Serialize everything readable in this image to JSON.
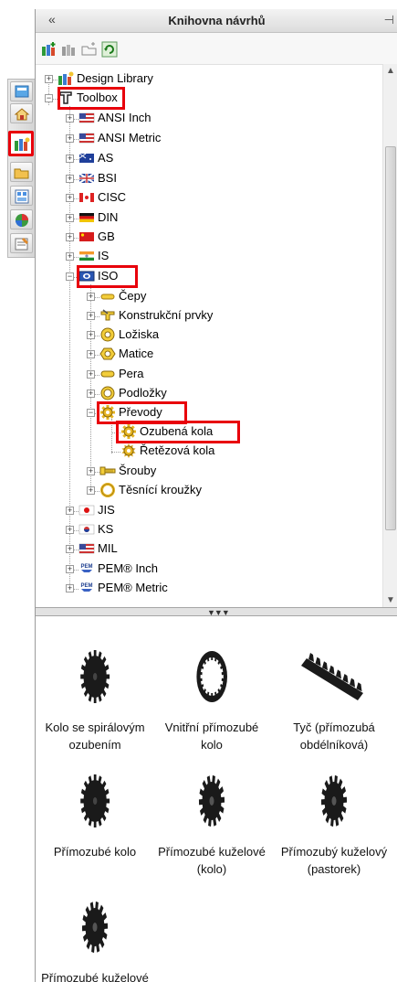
{
  "panel": {
    "title": "Knihovna návrhů",
    "collapse_glyph": "«",
    "pin_glyph": "⊣"
  },
  "side_tabs": [
    "home-icon",
    "design-library-icon",
    "folder-icon",
    "view-palette-icon",
    "appearances-icon",
    "custom-properties-icon",
    "resources-icon"
  ],
  "toolbar": [
    "add-to-library-icon",
    "add-file-location-icon",
    "create-folder-icon",
    "refresh-icon"
  ],
  "tree": [
    {
      "label": "Design Library",
      "icon": "design-library-icon",
      "expander": "+"
    },
    {
      "label": "Toolbox",
      "icon": "toolbox-icon",
      "expander": "−",
      "highlighted": true
    },
    {
      "label": "ANSI Inch",
      "icon": "us-flag-icon",
      "expander": "+"
    },
    {
      "label": "ANSI Metric",
      "icon": "us-flag-icon",
      "expander": "+"
    },
    {
      "label": "AS",
      "icon": "australia-flag-icon",
      "expander": "+"
    },
    {
      "label": "BSI",
      "icon": "uk-flag-icon",
      "expander": "+"
    },
    {
      "label": "CISC",
      "icon": "canada-flag-icon",
      "expander": "+"
    },
    {
      "label": "DIN",
      "icon": "germany-flag-icon",
      "expander": "+"
    },
    {
      "label": "GB",
      "icon": "china-flag-icon",
      "expander": "+"
    },
    {
      "label": "IS",
      "icon": "india-flag-icon",
      "expander": "+"
    },
    {
      "label": "ISO",
      "icon": "iso-icon",
      "expander": "−",
      "highlighted": true
    },
    {
      "label": "Čepy",
      "icon": "pin-part-icon",
      "expander": "+"
    },
    {
      "label": "Konstrukční prvky",
      "icon": "structural-icon",
      "expander": "+"
    },
    {
      "label": "Ložiska",
      "icon": "bearing-icon",
      "expander": "+"
    },
    {
      "label": "Matice",
      "icon": "nut-icon",
      "expander": "+"
    },
    {
      "label": "Pera",
      "icon": "key-icon",
      "expander": "+"
    },
    {
      "label": "Podložky",
      "icon": "washer-icon",
      "expander": "+"
    },
    {
      "label": "Převody",
      "icon": "gear-icon",
      "expander": "−",
      "highlighted": true
    },
    {
      "label": "Ozubená kola",
      "icon": "gear-icon",
      "expander": "",
      "highlighted": true
    },
    {
      "label": "Řetězová kola",
      "icon": "sprocket-icon",
      "expander": ""
    },
    {
      "label": "Šrouby",
      "icon": "bolt-icon",
      "expander": "+"
    },
    {
      "label": "Těsnící kroužky",
      "icon": "o-ring-icon",
      "expander": "+"
    },
    {
      "label": "JIS",
      "icon": "japan-flag-icon",
      "expander": "+"
    },
    {
      "label": "KS",
      "icon": "korea-flag-icon",
      "expander": "+"
    },
    {
      "label": "MIL",
      "icon": "us-flag-icon",
      "expander": "+"
    },
    {
      "label": "PEM® Inch",
      "icon": "pem-icon",
      "expander": "+"
    },
    {
      "label": "PEM® Metric",
      "icon": "pem-icon",
      "expander": "+"
    }
  ],
  "palette": [
    {
      "caption": "Kolo se spirálovým ozubením",
      "icon": "helical-gear-icon"
    },
    {
      "caption": "Vnitřní přímozubé kolo",
      "icon": "internal-gear-icon"
    },
    {
      "caption": "Tyč (přímozubá obdélníková)",
      "icon": "rack-icon"
    },
    {
      "caption": "Přímozubé kolo",
      "icon": "spur-gear-icon"
    },
    {
      "caption": "Přímozubé kuželové (kolo)",
      "icon": "bevel-gear-icon"
    },
    {
      "caption": "Přímozubý kuželový (pastorek)",
      "icon": "bevel-pinion-icon"
    },
    {
      "caption": "Přímozubé kuželové kolo",
      "icon": "miter-gear-icon"
    }
  ],
  "colors": {
    "highlight": "#e8000b",
    "gear_dark": "#1a1a1a",
    "part_gold": "#e6b422"
  }
}
